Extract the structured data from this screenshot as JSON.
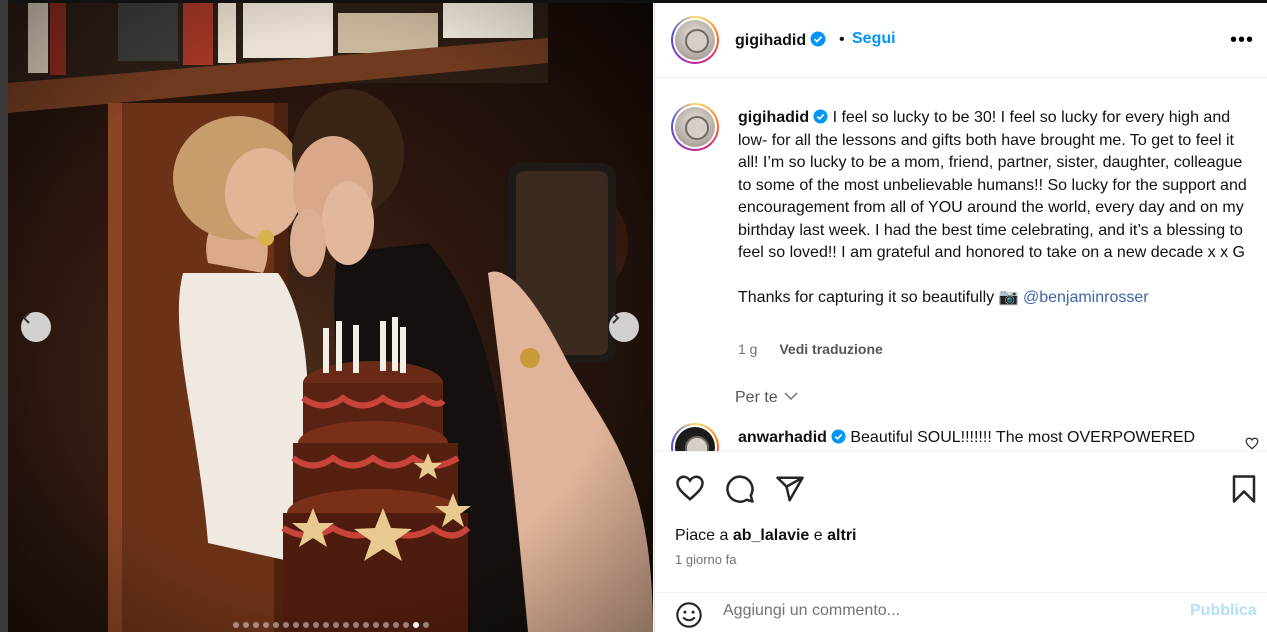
{
  "post": {
    "author": "gigihadid",
    "follow_label": "Segui",
    "dot_separator": "•",
    "more_label": "•••"
  },
  "caption": {
    "author": "gigihadid",
    "text_1": "I feel so lucky to be 30! I feel so lucky for every high and low- for all the lessons and gifts both have brought me. To get to feel it all! I’m so lucky to be a mom, friend, partner, sister, daughter, colleague to some of the most unbelievable humans!! So lucky for the support and encouragement from all of YOU around the world, every day and on my birthday last week. I had the best time celebrating, and it’s a blessing to feel so loved!! I am grateful and honored to take on a new decade x x G",
    "text_2": "Thanks for capturing it so beautifully 📷 ",
    "mention": "@benjaminrosser",
    "age": "1 g",
    "translate_label": "Vedi traduzione"
  },
  "comments": {
    "filter_label": "Per te",
    "items": [
      {
        "user": "anwarhadid",
        "text": "Beautiful SOUL!!!!!!! The most OVERPOWERED"
      }
    ]
  },
  "likes": {
    "prefix": "Piace a",
    "user": "ab_lalavie",
    "conj": "e",
    "others": "altri"
  },
  "timestamp": "1 giorno fa",
  "add_comment": {
    "placeholder": "Aggiungi un commento...",
    "publish_label": "Pubblica"
  },
  "carousel": {
    "slide_count": 20,
    "active_index": 18
  },
  "colors": {
    "accent": "#0095f6",
    "publish_disabled": "#b2dffc",
    "verified": "#0095f6",
    "muted": "#737373"
  }
}
